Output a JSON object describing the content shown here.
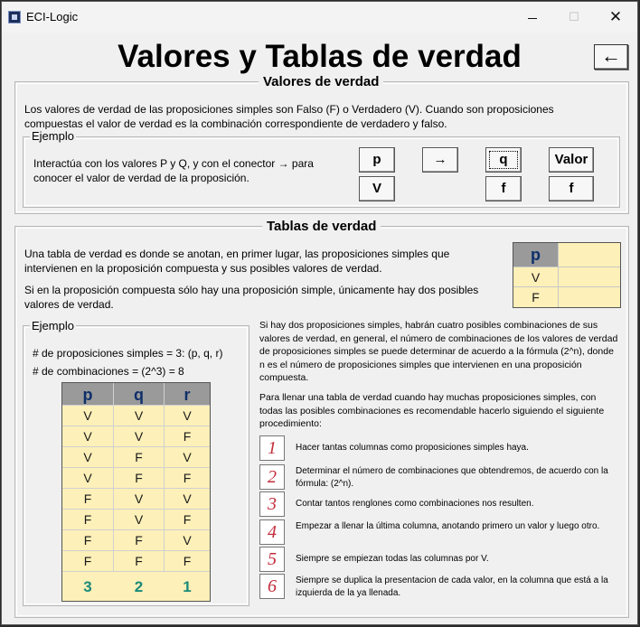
{
  "window": {
    "title": "ECI-Logic",
    "minimize": "",
    "maximize": "☐",
    "close": "✕"
  },
  "header": {
    "title": "Valores y Tablas de verdad",
    "back_label": "←"
  },
  "valores": {
    "title": "Valores de verdad",
    "description": "Los valores de verdad de las proposiciones simples son Falso (F) o Verdadero (V). Cuando son proposiciones compuestas el valor de verdad es la combinación correspondiente de verdadero y falso.",
    "example": {
      "title": "Ejemplo",
      "text": "Interactúa con los valores P y Q, y con el conector → para conocer el valor de verdad de la proposición.",
      "p_label": "p",
      "p_value": "V",
      "connector": "→",
      "q_label": "q",
      "q_value": "f",
      "result_label": "Valor",
      "result_value": "f"
    }
  },
  "tablas": {
    "title": "Tablas de verdad",
    "para1": "Una tabla de verdad es donde se anotan, en primer lugar, las proposiciones simples que intervienen en la proposición compuesta y sus posibles valores de verdad.",
    "para2": "Si en la proposición compuesta sólo hay una proposición simple, únicamente hay dos posibles valores de verdad.",
    "simple_table": {
      "header": "p",
      "values": [
        "V",
        "F"
      ]
    },
    "example": {
      "title": "Ejemplo",
      "line1": "# de proposiciones simples = 3: (p, q, r)",
      "line2": "# de combinaciones = (2^3) = 8",
      "headers": [
        "p",
        "q",
        "r"
      ],
      "rows": [
        [
          "V",
          "V",
          "V"
        ],
        [
          "V",
          "V",
          "F"
        ],
        [
          "V",
          "F",
          "V"
        ],
        [
          "V",
          "F",
          "F"
        ],
        [
          "F",
          "V",
          "V"
        ],
        [
          "F",
          "V",
          "F"
        ],
        [
          "F",
          "F",
          "V"
        ],
        [
          "F",
          "F",
          "F"
        ]
      ],
      "footer": [
        "3",
        "2",
        "1"
      ]
    },
    "right_para1": "Si hay dos proposiciones simples, habrán cuatro posibles combinaciones de sus valores de verdad, en general, el número de combinaciones de los valores de verdad de proposiciones simples se puede determinar de acuerdo a la fórmula (2^n), donde n es el número de proposiciones simples que intervienen en una proposición compuesta.",
    "right_para2": "Para llenar una tabla de verdad cuando hay muchas proposiciones simples, con todas las posibles combinaciones es recomendable hacerlo siguiendo el siguiente procedimiento:",
    "steps": [
      {
        "num": "1",
        "text": "Hacer tantas columnas como proposiciones simples haya."
      },
      {
        "num": "2",
        "text": "Determinar el número de combinaciones que obtendremos, de acuerdo con la fórmula: (2^n)."
      },
      {
        "num": "3",
        "text": "Contar tantos renglones como combinaciones nos resulten."
      },
      {
        "num": "4",
        "text": "Empezar a llenar la última columna, anotando primero un valor y luego otro."
      },
      {
        "num": "5",
        "text": "Siempre se empiezan todas las columnas por V."
      },
      {
        "num": "6",
        "text": "Siempre se duplica la presentacion de cada valor, en la columna que está a la izquierda de la ya llenada."
      }
    ]
  }
}
